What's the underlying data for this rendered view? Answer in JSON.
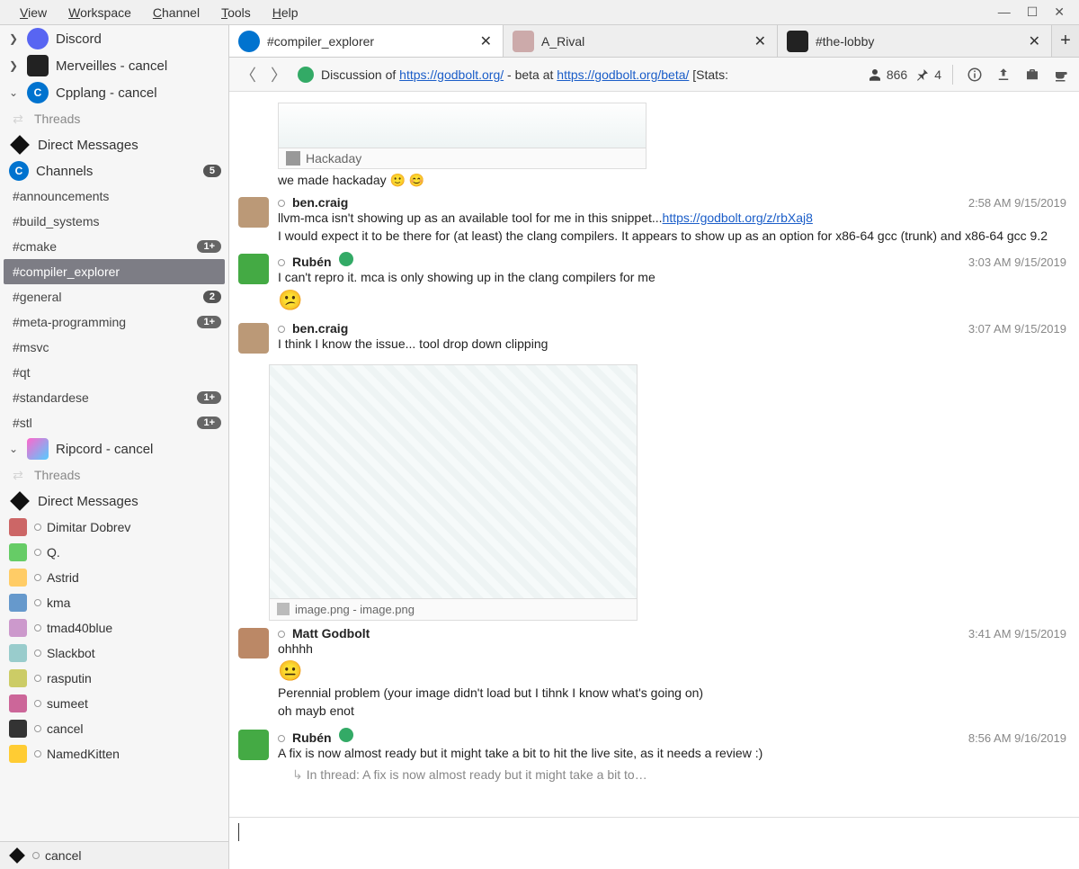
{
  "menu": {
    "items": [
      "View",
      "Workspace",
      "Channel",
      "Tools",
      "Help"
    ]
  },
  "sidebar": {
    "servers": [
      {
        "name": "Discord",
        "collapsed": true
      },
      {
        "name": "Merveilles - cancel",
        "collapsed": true
      },
      {
        "name": "Cpplang - cancel",
        "collapsed": false
      }
    ],
    "cpplang": {
      "threads_label": "Threads",
      "dm_label": "Direct Messages",
      "channels_label": "Channels",
      "channels_badge": "5",
      "channels": [
        {
          "label": "#announcements",
          "badge": ""
        },
        {
          "label": "#build_systems",
          "badge": ""
        },
        {
          "label": "#cmake",
          "badge": "1+"
        },
        {
          "label": "#compiler_explorer",
          "badge": "",
          "selected": true
        },
        {
          "label": "#general",
          "badge": "2"
        },
        {
          "label": "#meta-programming",
          "badge": "1+"
        },
        {
          "label": "#msvc",
          "badge": ""
        },
        {
          "label": "#qt",
          "badge": ""
        },
        {
          "label": "#standardese",
          "badge": "1+"
        },
        {
          "label": "#stl",
          "badge": "1+"
        }
      ]
    },
    "ripcord": {
      "label": "Ripcord - cancel",
      "threads_label": "Threads",
      "dm_label": "Direct Messages",
      "users": [
        "Dimitar Dobrev",
        "Q.",
        "Astrid",
        "kma",
        "tmad40blue",
        "Slackbot",
        "rasputin",
        "sumeet",
        "cancel",
        "NamedKitten"
      ]
    },
    "footer_user": "cancel"
  },
  "tabs": [
    {
      "label": "#compiler_explorer",
      "kind": "cpp",
      "active": true
    },
    {
      "label": "A_Rival",
      "kind": "rival",
      "active": false
    },
    {
      "label": "#the-lobby",
      "kind": "lobby",
      "active": false
    }
  ],
  "topic": {
    "prefix": "Discussion of ",
    "link1": "https://godbolt.org/",
    "mid": " - beta at ",
    "link2": "https://godbolt.org/beta/",
    "suffix": " [Stats:",
    "member_count": "866",
    "pin_count": "4"
  },
  "messages": [
    {
      "type": "leading_attachment",
      "caption_label": "Hackaday",
      "trailing_text": "we made hackaday 🙂 😊"
    },
    {
      "type": "msg",
      "author": "ben.craig",
      "time": "2:58 AM",
      "date": "9/15/2019",
      "lines": [
        {
          "segments": [
            {
              "t": "llvm-mca isn't showing up as an available tool for me in this snippet..."
            },
            {
              "t": "https://godbolt.org/z/rbXaj8",
              "link": true
            }
          ]
        },
        {
          "segments": [
            {
              "t": "I would expect it to be there for (at least) the clang compilers.  It appears to show up as an option for x86-64 gcc (trunk) and x86-64 gcc 9.2"
            }
          ]
        }
      ]
    },
    {
      "type": "msg",
      "author": "Rubén",
      "badge": true,
      "time": "3:03 AM",
      "date": "9/15/2019",
      "lines": [
        {
          "segments": [
            {
              "t": "I can't repro it. mca is only showing up in the clang compilers for me"
            }
          ]
        }
      ],
      "reaction": "😕"
    },
    {
      "type": "msg",
      "author": "ben.craig",
      "time": "3:07 AM",
      "date": "9/15/2019",
      "lines": [
        {
          "segments": [
            {
              "t": "I think I know the issue... tool drop down clipping"
            }
          ]
        }
      ],
      "attachment": {
        "caption": "image.png - image.png"
      }
    },
    {
      "type": "msg",
      "author": "Matt Godbolt",
      "time": "3:41 AM",
      "date": "9/15/2019",
      "lines": [
        {
          "segments": [
            {
              "t": "ohhhh"
            }
          ]
        }
      ],
      "reaction": "😐",
      "extra_lines": [
        "Perennial problem (your image didn't load but I tihnk I know what's going on)",
        "oh mayb enot"
      ]
    },
    {
      "type": "msg",
      "author": "Rubén",
      "badge": true,
      "time": "8:56 AM",
      "date": "9/16/2019",
      "lines": [
        {
          "segments": [
            {
              "t": "A fix is now almost ready but it might take a bit to hit the live site, as it needs a review :)"
            }
          ]
        }
      ],
      "thread_ref": "In thread: A fix is now almost ready but it might take a bit to…"
    }
  ],
  "input": {
    "placeholder": ""
  }
}
